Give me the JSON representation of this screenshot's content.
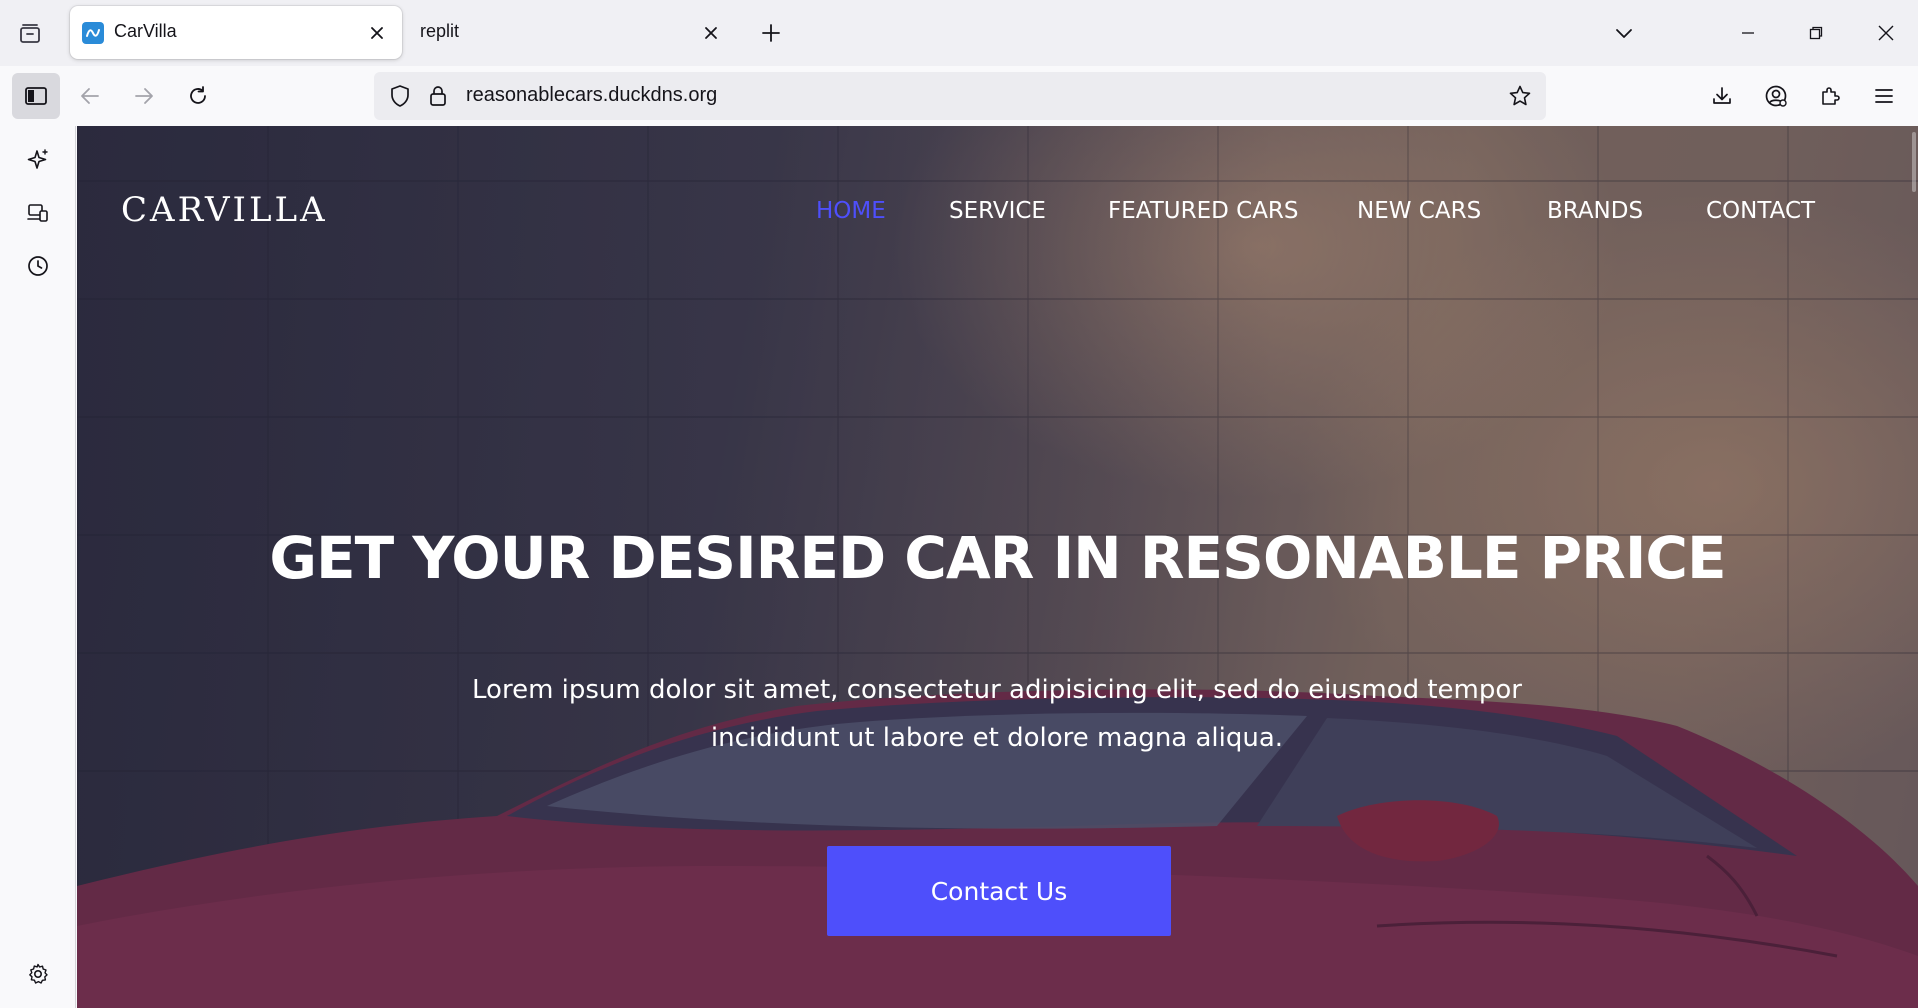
{
  "browser": {
    "tabs": [
      {
        "title": "CarVilla",
        "active": true,
        "favicon": "replit-favicon"
      },
      {
        "title": "replit",
        "active": false
      }
    ],
    "url": "reasonablecars.duckdns.org"
  },
  "site": {
    "logo": "CARVILLA",
    "menu": [
      "HOME",
      "SERVICE",
      "FEATURED CARS",
      "NEW CARS",
      "BRANDS",
      "CONTACT"
    ],
    "active_menu": "HOME",
    "headline": "GET YOUR DESIRED CAR IN RESONABLE PRICE",
    "subtext": "Lorem ipsum dolor sit amet, consectetur adipisicing elit, sed do eiusmod tempor incididunt ut labore et dolore magna aliqua.",
    "cta_label": "Contact Us"
  },
  "colors": {
    "accent": "#4e4ffb",
    "tab_strip": "#f0f0f4",
    "toolbar": "#f9f9fb"
  }
}
